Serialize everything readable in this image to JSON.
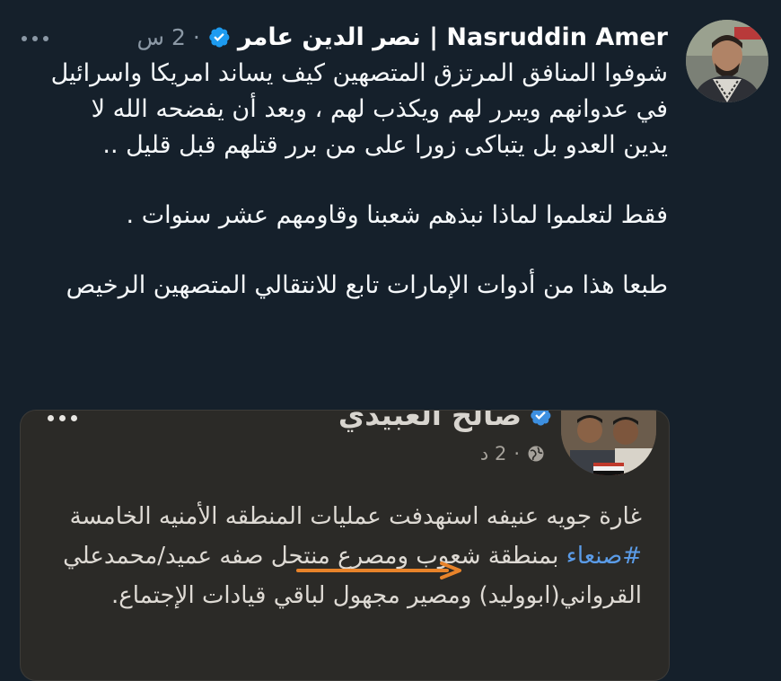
{
  "tweet": {
    "author": {
      "display_name": "نصر الدين عامر | Nasruddin Amer",
      "verified": true
    },
    "timestamp": "2 س",
    "separator": "·",
    "more_icon": "more-horizontal-icon",
    "paragraphs": [
      "شوفوا المنافق المرتزق المتصهين كيف يساند امريكا واسرائيل في عدوانهم ويبرر لهم ويكذب لهم ، وبعد أن يفضحه الله لا يدين العدو بل يتباكى زورا على من برر قتلهم قبل قليل ..",
      "فقط لتعلموا لماذا نبذهم شعبنا وقاومهم عشر سنوات .",
      "طبعا هذا من أدوات الإمارات تابع للانتقالي المتصهين الرخيص"
    ]
  },
  "embed": {
    "author_name": "صالح العبيدي",
    "verified": true,
    "timestamp": "2 د",
    "separator": "·",
    "audience_icon": "globe-icon",
    "text_before_hashtag": "غارة جويه عنيفه استهدفت عمليات المنطقه الأمنيه الخامسة ",
    "hashtag": "#صنعاء",
    "text_after_hashtag": " بمنطقة شعوب ومصرع منتحل صفه عميد/محمدعلي القرواني(ابووليد) ومصير مجهول لباقي قيادات الإجتماع.",
    "annotation_color": "#e8832a"
  },
  "colors": {
    "background": "#15202b",
    "verified_blue": "#1d9bf0",
    "hashtag_blue": "#5b9ce8",
    "secondary_text": "#8b98a5"
  }
}
